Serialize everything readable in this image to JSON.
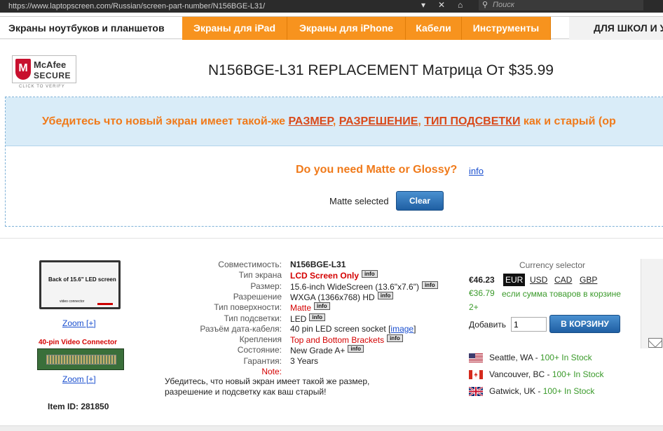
{
  "browser": {
    "url": "https://www.laptopscreen.com/Russian/screen-part-number/N156BGE-L31/",
    "search_placeholder": "Поиск"
  },
  "nav": {
    "home": "Экраны ноутбуков и планшетов",
    "tabs": [
      "Экраны для iPad",
      "Экраны для iPhone",
      "Кабели",
      "Инструменты"
    ],
    "school": "ДЛЯ ШКОЛ И У"
  },
  "header": {
    "mcafee": {
      "line1": "McAfee",
      "line2": "SECURE",
      "line3": "CLICK TO VERIFY"
    },
    "title": "N156BGE-L31 REPLACEMENT Матрица От $35.99"
  },
  "notice": {
    "warning_start": "Убедитесь что новый экран имеет такой-же ",
    "size": "РАЗМЕР",
    "resolution": "РАЗРЕШЕНИЕ",
    "backlight": "ТИП ПОДСВЕТКИ",
    "warning_end": " как и старый (ор",
    "question": "Do you need Matte or Glossy?",
    "info_link": "info",
    "selected_text": "Matte selected",
    "clear_button": "Clear"
  },
  "product": {
    "image_label": "Back of 15.6\" LED screen",
    "image_sub": "video connector",
    "zoom1": "Zoom [+]",
    "connector_title": "40-pin Video Connector",
    "zoom2": "Zoom [+]",
    "item_id": "Item ID: 281850"
  },
  "specs": [
    {
      "key": "Совместимость:",
      "value": "N156BGE-L31",
      "style": "bold",
      "badge": ""
    },
    {
      "key": "Тип экрана",
      "value": "LCD Screen Only",
      "style": "red bold",
      "badge": "info"
    },
    {
      "key": "Размер:",
      "value": "15.6-inch WideScreen (13.6\"x7.6\")",
      "style": "",
      "badge": "info"
    },
    {
      "key": "Разрешение",
      "value": "WXGA (1366x768) HD",
      "style": "",
      "badge": "info"
    },
    {
      "key": "Тип поверхности:",
      "value": "Matte",
      "style": "red",
      "badge": "info"
    },
    {
      "key": "Тип подсветки:",
      "value": "LED",
      "style": "",
      "badge": "info"
    },
    {
      "key": "Разъём дата-кабеля:",
      "value": "40 pin LED screen socket",
      "style": "",
      "badge": "",
      "link": "image"
    },
    {
      "key": "Крепления",
      "value": "Top and Bottom Brackets",
      "style": "red",
      "badge": "info"
    },
    {
      "key": "Состояние:",
      "value": "New Grade A+",
      "style": "",
      "badge": "info"
    },
    {
      "key": "Гарантия:",
      "value": "3 Years",
      "style": "",
      "badge": ""
    },
    {
      "key": "Note:",
      "value": "",
      "style": "",
      "badge": "",
      "key_red": true
    }
  ],
  "note_text_1": "Убедитесь, что новый экран имеет такой же размер,",
  "note_text_2": "разрешение и подсветку как ваш старый!",
  "purchase": {
    "currency_label": "Currency selector",
    "price": "€46.23",
    "currencies": [
      "EUR",
      "USD",
      "CAD",
      "GBP"
    ],
    "selected_currency": "EUR",
    "alt_price": "€36.79",
    "alt_text": "если сумма товаров в корзине",
    "alt_text_2": "2+",
    "qty_label": "Добавить",
    "qty_value": "1",
    "cart_button": "В КОРЗИНУ"
  },
  "stock": [
    {
      "location": "Seattle, WA - ",
      "status": "100+ In Stock",
      "flag": "us-flag"
    },
    {
      "location": "Vancouver, BC - ",
      "status": "100+ In Stock",
      "flag": "ca-flag"
    },
    {
      "location": "Gatwick, UK - ",
      "status": "100+ In Stock",
      "flag": "uk-flag"
    }
  ]
}
